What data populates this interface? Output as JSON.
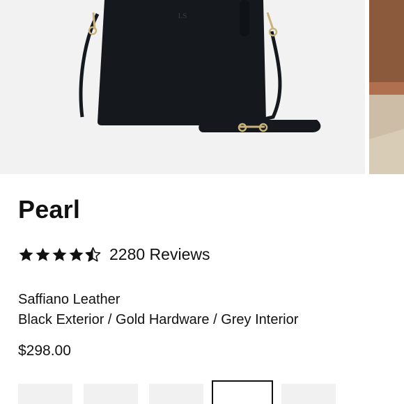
{
  "product": {
    "name": "Pearl",
    "rating": 4.5,
    "rating_max": 5,
    "reviews_text": "2280 Reviews",
    "material": "Saffiano Leather",
    "variant": "Black Exterior / Gold Hardware / Grey Interior",
    "price": "$298.00",
    "monogram": "LS"
  },
  "colors": {
    "text": "#111111",
    "bag": "#15181d",
    "hardware": "#c9b37a",
    "photo_bg": "#f2f2f2",
    "swatch_bg": "#f1f1f1",
    "selected_border": "#111111"
  },
  "swatches": [
    {
      "selected": false
    },
    {
      "selected": false
    },
    {
      "selected": false
    },
    {
      "selected": true
    },
    {
      "selected": false
    }
  ]
}
